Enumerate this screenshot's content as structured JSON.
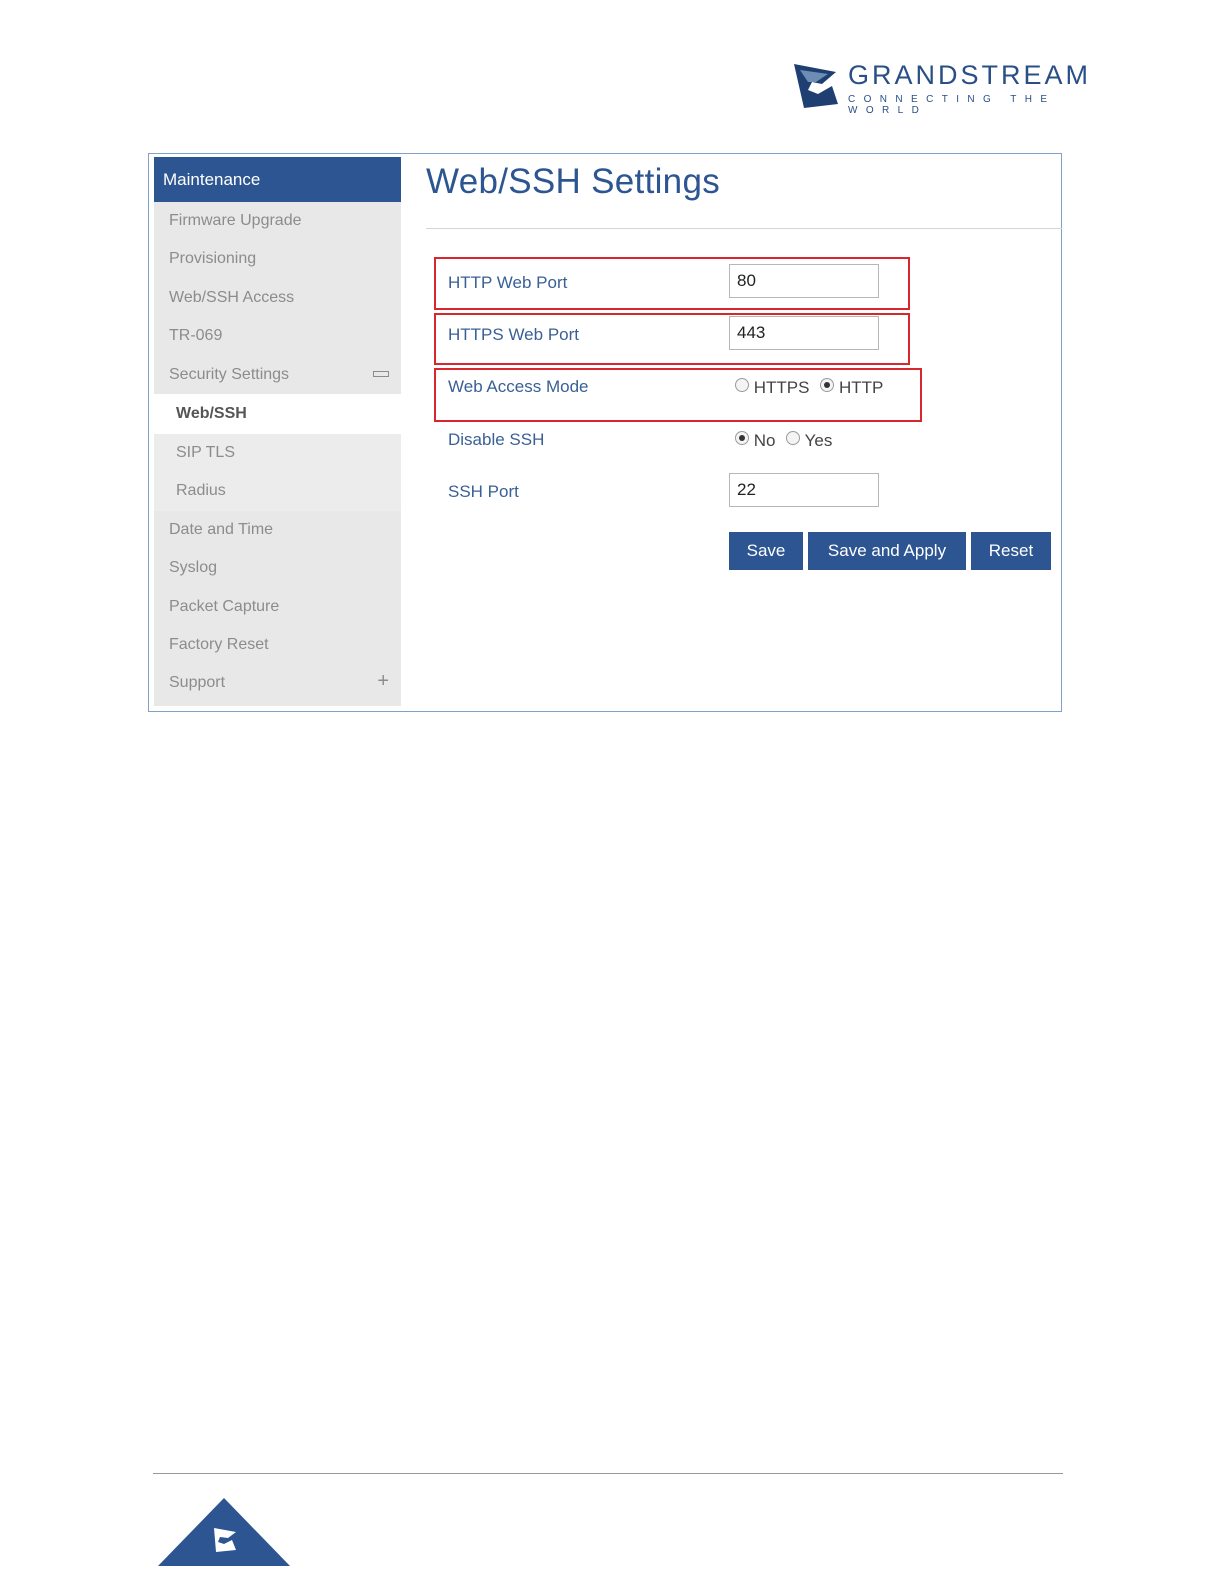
{
  "logo": {
    "brand": "GRANDSTREAM",
    "tagline": "CONNECTING THE WORLD"
  },
  "sidebar": {
    "header": "Maintenance",
    "items": [
      {
        "label": "Firmware Upgrade"
      },
      {
        "label": "Provisioning"
      },
      {
        "label": "Web/SSH Access"
      },
      {
        "label": "TR-069"
      },
      {
        "label": "Security Settings",
        "expanded": true
      },
      {
        "label": "Web/SSH",
        "active": true
      },
      {
        "label": "SIP TLS"
      },
      {
        "label": "Radius"
      },
      {
        "label": "Date and Time"
      },
      {
        "label": "Syslog"
      },
      {
        "label": "Packet Capture"
      },
      {
        "label": "Factory Reset"
      },
      {
        "label": "Support",
        "expanded": false
      }
    ]
  },
  "page": {
    "title": "Web/SSH Settings"
  },
  "form": {
    "http_port": {
      "label": "HTTP Web Port",
      "value": "80"
    },
    "https_port": {
      "label": "HTTPS Web Port",
      "value": "443"
    },
    "web_access_mode": {
      "label": "Web Access Mode",
      "options": [
        "HTTPS",
        "HTTP"
      ],
      "selected": "HTTP"
    },
    "disable_ssh": {
      "label": "Disable SSH",
      "options": [
        "No",
        "Yes"
      ],
      "selected": "No"
    },
    "ssh_port": {
      "label": "SSH Port",
      "value": "22"
    }
  },
  "buttons": {
    "save": "Save",
    "save_apply": "Save and Apply",
    "reset": "Reset"
  },
  "colors": {
    "accent": "#2c5591",
    "highlight": "#d7262e"
  }
}
